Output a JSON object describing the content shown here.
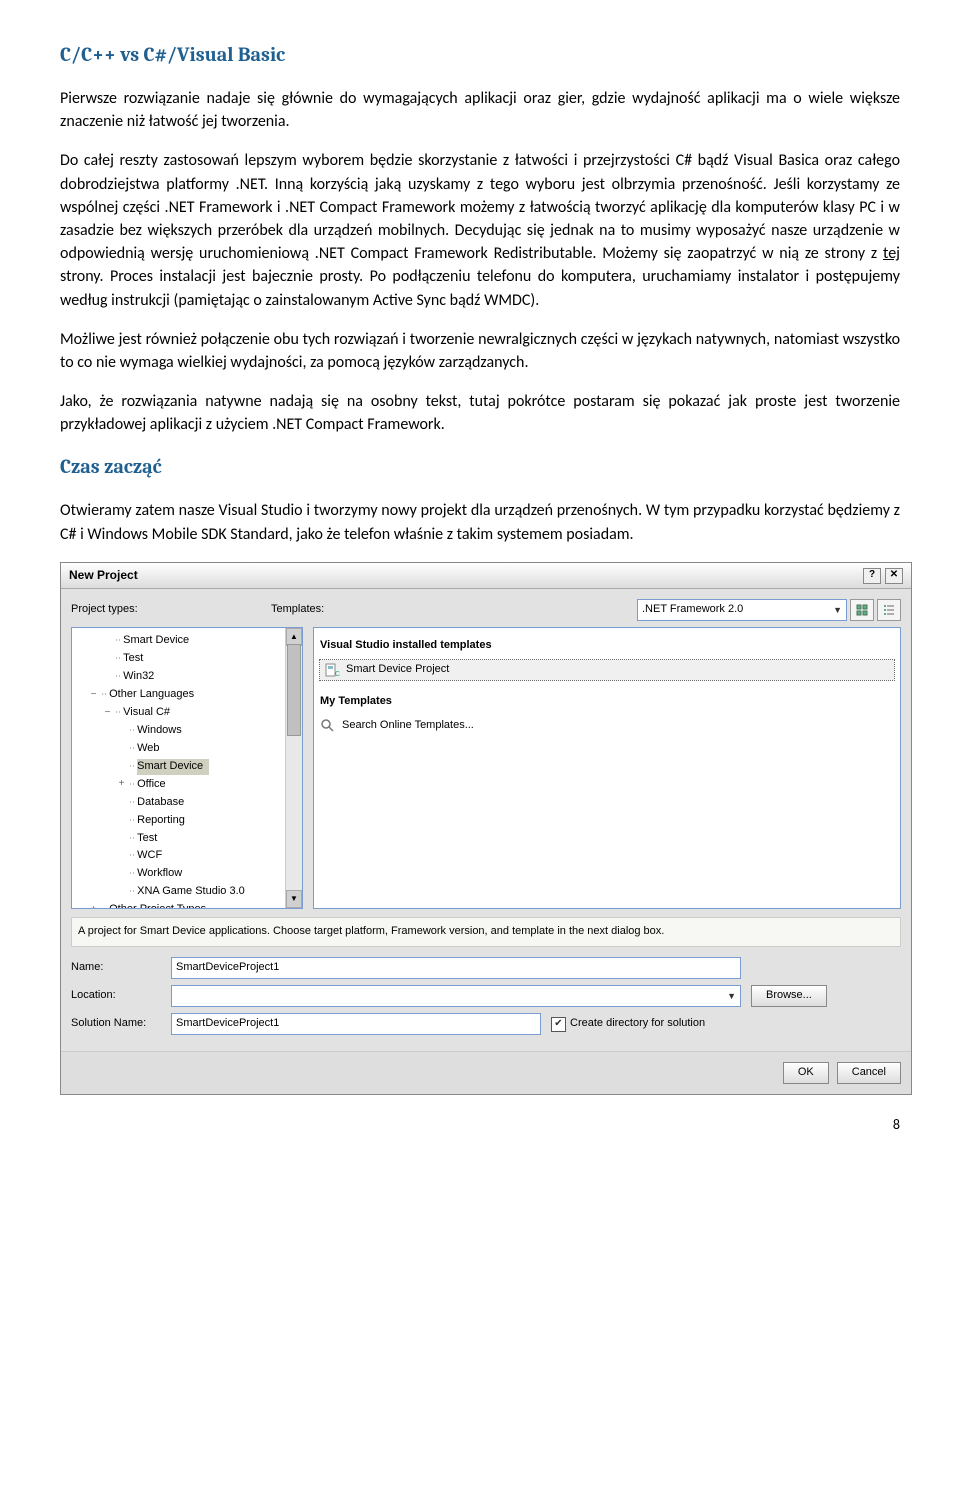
{
  "headings": {
    "h1": "C/C++ vs C#/Visual Basic",
    "h2": "Czas zacząć"
  },
  "paragraphs": {
    "p1": "Pierwsze rozwiązanie nadaje się głównie do wymagających aplikacji oraz gier, gdzie wydajność aplikacji ma o wiele większe znaczenie niż łatwość jej tworzenia.",
    "p2a": "Do całej reszty zastosowań lepszym wyborem będzie skorzystanie z łatwości i przejrzystości C# bądź Visual Basica oraz całego dobrodziejstwa platformy .NET. Inną korzyścią jaką uzyskamy z tego wyboru jest olbrzymia przenośność. Jeśli korzystamy ze wspólnej części .NET Framework i .NET Compact Framework możemy z łatwością tworzyć aplikację dla komputerów klasy PC i w zasadzie bez większych przeróbek dla urządzeń mobilnych.  Decydując się jednak na to musimy wyposażyć nasze urządzenie w odpowiednią wersję uruchomieniową .NET Compact Framework Redistributable. Możemy się zaopatrzyć w nią ze strony z ",
    "p2link": "tej",
    "p2b": " strony. Proces instalacji jest bajecznie prosty. Po podłączeniu telefonu do komputera, uruchamiamy instalator i postępujemy według instrukcji (pamiętając o zainstalowanym Active Sync bądź WMDC).",
    "p3": "Możliwe jest również połączenie obu tych rozwiązań i tworzenie newralgicznych części w językach natywnych, natomiast wszystko to co nie wymaga wielkiej wydajności, za pomocą języków zarządzanych.",
    "p4": "Jako, że rozwiązania natywne nadają się na osobny tekst, tutaj pokrótce postaram się pokazać jak proste jest tworzenie przykładowej aplikacji z użyciem .NET Compact Framework.",
    "p5": "Otwieramy zatem nasze Visual Studio i tworzymy nowy projekt dla urządzeń przenośnych. W tym przypadku korzystać będziemy z C# i Windows Mobile SDK Standard, jako że telefon właśnie z takim systemem posiadam."
  },
  "dialog": {
    "title": "New Project",
    "labels": {
      "project_types": "Project types:",
      "templates": "Templates:",
      "framework": ".NET Framework 2.0",
      "name": "Name:",
      "location": "Location:",
      "solution_name": "Solution Name:",
      "browse": "Browse...",
      "ok": "OK",
      "cancel": "Cancel",
      "create_dir": "Create directory for solution"
    },
    "tree": [
      {
        "lvl": 2,
        "tw": "",
        "txt": "Smart Device"
      },
      {
        "lvl": 2,
        "tw": "",
        "txt": "Test"
      },
      {
        "lvl": 2,
        "tw": "",
        "txt": "Win32"
      },
      {
        "lvl": 1,
        "tw": "−",
        "txt": "Other Languages"
      },
      {
        "lvl": 2,
        "tw": "−",
        "txt": "Visual C#"
      },
      {
        "lvl": 3,
        "tw": "",
        "txt": "Windows"
      },
      {
        "lvl": 3,
        "tw": "",
        "txt": "Web"
      },
      {
        "lvl": 3,
        "tw": "",
        "txt": "Smart Device",
        "sel": true
      },
      {
        "lvl": 3,
        "tw": "+",
        "txt": "Office"
      },
      {
        "lvl": 3,
        "tw": "",
        "txt": "Database"
      },
      {
        "lvl": 3,
        "tw": "",
        "txt": "Reporting"
      },
      {
        "lvl": 3,
        "tw": "",
        "txt": "Test"
      },
      {
        "lvl": 3,
        "tw": "",
        "txt": "WCF"
      },
      {
        "lvl": 3,
        "tw": "",
        "txt": "Workflow"
      },
      {
        "lvl": 3,
        "tw": "",
        "txt": "XNA Game Studio 3.0"
      },
      {
        "lvl": 1,
        "tw": "+",
        "txt": "Other Project Types"
      }
    ],
    "templates": {
      "group1": "Visual Studio installed templates",
      "item1": "Smart Device Project",
      "group2": "My Templates",
      "item2": "Search Online Templates..."
    },
    "description": "A project for Smart Device applications. Choose target platform, Framework version, and template in the next dialog box.",
    "fields": {
      "name_value": "SmartDeviceProject1",
      "location_value": "",
      "solution_value": "SmartDeviceProject1"
    }
  },
  "page_number": "8"
}
